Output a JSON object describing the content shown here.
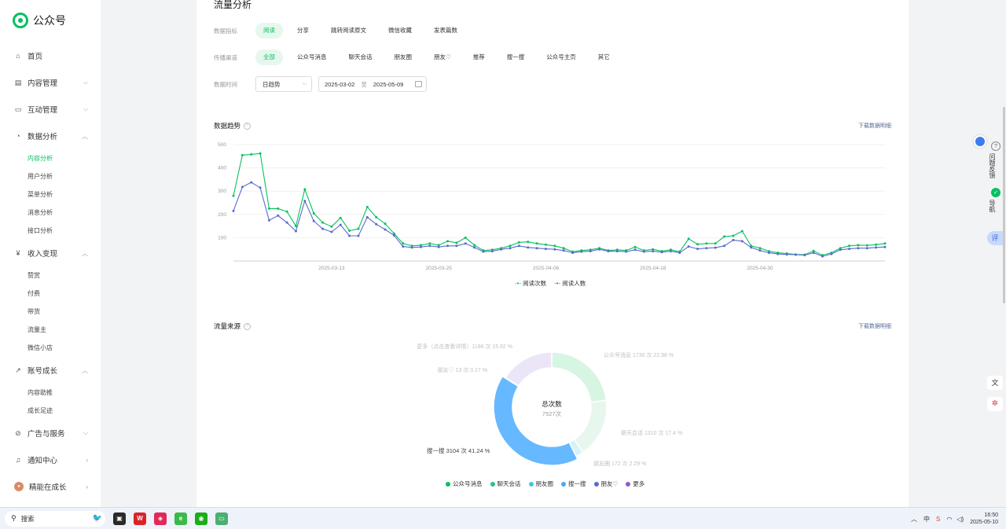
{
  "app": {
    "name": "公众号"
  },
  "sidebar": {
    "items": [
      {
        "label": "首页",
        "icon": "home-icon"
      },
      {
        "label": "内容管理",
        "icon": "document-icon"
      },
      {
        "label": "互动管理",
        "icon": "chat-icon"
      },
      {
        "label": "数据分析",
        "icon": "analytics-icon"
      },
      {
        "label": "收入变现",
        "icon": "money-icon"
      },
      {
        "label": "账号成长",
        "icon": "growth-icon"
      },
      {
        "label": "广告与服务",
        "icon": "ad-icon"
      },
      {
        "label": "通知中心",
        "icon": "bell-icon"
      },
      {
        "label": "精能在成长",
        "icon": "avatar-icon"
      }
    ],
    "analysis_sub": [
      "内容分析",
      "用户分析",
      "菜单分析",
      "消息分析",
      "接口分析"
    ],
    "income_sub": [
      "赞赏",
      "付费",
      "带货",
      "流量主",
      "微信小店"
    ],
    "growth_sub": [
      "内容助推",
      "成长足迹"
    ]
  },
  "page": {
    "title": "流量分析"
  },
  "filters": {
    "metric_label": "数据指标",
    "metrics": [
      "阅读",
      "分享",
      "跳转阅读原文",
      "微信收藏",
      "发表篇数"
    ],
    "channel_label": "传播渠道",
    "channels": [
      "全部",
      "公众号消息",
      "聊天会话",
      "朋友圈",
      "朋友♡",
      "推荐",
      "搜一搜",
      "公众号主页",
      "其它"
    ],
    "time_label": "数据时间",
    "granularity": "日趋势",
    "date_start": "2025-03-02",
    "date_sep": "至",
    "date_end": "2025-05-09"
  },
  "trend": {
    "title": "数据趋势",
    "download": "下载数据明细",
    "legend": [
      "阅读次数",
      "阅读人数"
    ]
  },
  "source": {
    "title": "流量来源",
    "download": "下载数据明细",
    "center_title": "总次数",
    "center_value": "7527次",
    "legend": [
      "公众号消息",
      "聊天会话",
      "朋友圈",
      "搜一搜",
      "朋友♡",
      "更多"
    ],
    "labels": {
      "more": "更多（点击查看详情）1198 次 15.92 %",
      "friend": "朋友♡ 13 次 0.17 %",
      "msg": "公众号消息 1730 次 22.98 %",
      "chat": "聊天会话 1310 次 17.4 %",
      "moments": "朋友圈 172 次 2.29 %",
      "search": "搜一搜 3104 次 41.24 %"
    }
  },
  "right_tools": {
    "feedback": "问题反馈",
    "nav": "导航",
    "review": "评"
  },
  "taskbar": {
    "search_placeholder": "搜索",
    "ime": "中",
    "time": "16:50",
    "date": "2025-05-10"
  },
  "chart_data": [
    {
      "type": "line",
      "title": "数据趋势",
      "x_ticks": [
        "2025-03-13",
        "2025-03-25",
        "2025-04-06",
        "2025-04-18",
        "2025-04-30"
      ],
      "ylim": [
        0,
        500
      ],
      "y_ticks": [
        100,
        200,
        300,
        400,
        500
      ],
      "x_start": "2025-03-02",
      "x_end": "2025-05-09",
      "colors": {
        "reads": "#07c160",
        "readers": "#5b6bcc"
      },
      "series": [
        {
          "name": "阅读次数",
          "values": [
            280,
            455,
            458,
            462,
            225,
            225,
            212,
            150,
            308,
            205,
            165,
            148,
            185,
            130,
            138,
            232,
            188,
            160,
            118,
            75,
            65,
            68,
            75,
            68,
            85,
            78,
            100,
            68,
            45,
            48,
            55,
            65,
            80,
            82,
            75,
            70,
            65,
            55,
            40,
            45,
            48,
            55,
            45,
            48,
            45,
            60,
            45,
            50,
            42,
            48,
            40,
            95,
            72,
            75,
            75,
            105,
            108,
            128,
            65,
            55,
            42,
            35,
            32,
            28,
            27,
            43,
            25,
            35,
            55,
            65,
            68,
            67,
            70,
            75
          ]
        },
        {
          "name": "阅读人数",
          "values": [
            215,
            318,
            338,
            315,
            175,
            195,
            165,
            128,
            258,
            172,
            138,
            125,
            155,
            108,
            108,
            188,
            158,
            135,
            110,
            62,
            58,
            60,
            65,
            60,
            65,
            65,
            75,
            58,
            40,
            42,
            50,
            55,
            65,
            58,
            55,
            52,
            50,
            45,
            35,
            40,
            42,
            50,
            42,
            42,
            40,
            48,
            40,
            42,
            38,
            42,
            35,
            62,
            52,
            55,
            57,
            65,
            90,
            85,
            58,
            45,
            35,
            30,
            28,
            27,
            25,
            35,
            20,
            30,
            48,
            52,
            55,
            55,
            58,
            60
          ]
        }
      ]
    },
    {
      "type": "pie",
      "title": "流量来源",
      "total": 7527,
      "slices": [
        {
          "name": "公众号消息",
          "value": 1730,
          "percent": 22.98,
          "color": "#d7f5e3"
        },
        {
          "name": "聊天会话",
          "value": 1310,
          "percent": 17.4,
          "color": "#e8f7ee"
        },
        {
          "name": "朋友圈",
          "value": 172,
          "percent": 2.29,
          "color": "#d6f3f7"
        },
        {
          "name": "搜一搜",
          "value": 3104,
          "percent": 41.24,
          "color": "#66b8ff"
        },
        {
          "name": "朋友♡",
          "value": 13,
          "percent": 0.17,
          "color": "#dfe5fb"
        },
        {
          "name": "更多（点击查看详情）",
          "value": 1198,
          "percent": 15.92,
          "color": "#ece5f7"
        }
      ],
      "legend_colors": [
        "#07c160",
        "#2bbf8a",
        "#3ec9d6",
        "#4aa8f5",
        "#5b6bcc",
        "#8a5cd6"
      ]
    }
  ]
}
